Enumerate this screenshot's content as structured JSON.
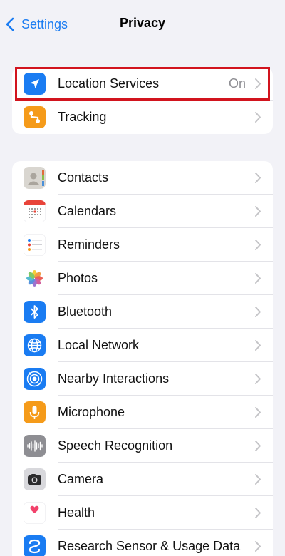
{
  "nav": {
    "back_label": "Settings",
    "title": "Privacy"
  },
  "group1": [
    {
      "label": "Location Services",
      "value": "On",
      "icon": "location-arrow-icon",
      "color": "#1a7cf2"
    },
    {
      "label": "Tracking",
      "icon": "tracking-icon",
      "color": "#f59b1a"
    }
  ],
  "group2": [
    {
      "label": "Contacts",
      "icon": "contacts-icon"
    },
    {
      "label": "Calendars",
      "icon": "calendar-icon"
    },
    {
      "label": "Reminders",
      "icon": "reminders-icon"
    },
    {
      "label": "Photos",
      "icon": "photos-icon"
    },
    {
      "label": "Bluetooth",
      "icon": "bluetooth-icon",
      "color": "#1a7cf2"
    },
    {
      "label": "Local Network",
      "icon": "globe-icon",
      "color": "#1a7cf2"
    },
    {
      "label": "Nearby Interactions",
      "icon": "nearby-interactions-icon",
      "color": "#1a7cf2"
    },
    {
      "label": "Microphone",
      "icon": "microphone-icon",
      "color": "#f59b1a"
    },
    {
      "label": "Speech Recognition",
      "icon": "waveform-icon",
      "color": "#8e8e93"
    },
    {
      "label": "Camera",
      "icon": "camera-icon",
      "color": "#3a3a3c"
    },
    {
      "label": "Health",
      "icon": "heart-icon"
    },
    {
      "label": "Research Sensor & Usage Data",
      "icon": "research-icon",
      "color": "#1a7cf2"
    }
  ],
  "accent_color": "#1a7cf2",
  "highlight_color": "#d2141e"
}
